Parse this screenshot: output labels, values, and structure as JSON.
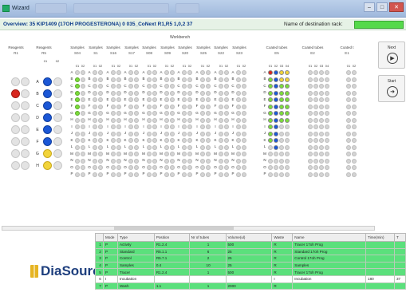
{
  "window": {
    "title": "Wizard",
    "controls": {
      "minimize": "–",
      "maximize": "□",
      "close": "✕"
    }
  },
  "overview": {
    "text": "Overview: 35 KIP1409 (17OH PROGESTERONA) 0 035_CoNext R1,R5 1,0,2 37",
    "rack_label": "Name of destination rack:",
    "rack_value": ""
  },
  "workbench": {
    "label": "Workbench",
    "columns": [
      {
        "id": "reagents1",
        "head": "Reagents",
        "sub": "R1"
      },
      {
        "id": "reagents2",
        "head": "Reagents",
        "sub": "R5"
      },
      {
        "id": "s1",
        "head": "Samples",
        "sub": "S04"
      },
      {
        "id": "s2",
        "head": "Samples",
        "sub": "S1"
      },
      {
        "id": "s3",
        "head": "Samples",
        "sub": "S16"
      },
      {
        "id": "s4",
        "head": "Samples",
        "sub": "S17"
      },
      {
        "id": "s5",
        "head": "Samples",
        "sub": "S08"
      },
      {
        "id": "s6",
        "head": "Samples",
        "sub": "S09"
      },
      {
        "id": "s7",
        "head": "Samples",
        "sub": "S20"
      },
      {
        "id": "s8",
        "head": "Samples",
        "sub": "S25"
      },
      {
        "id": "s9",
        "head": "Samples",
        "sub": "S22"
      },
      {
        "id": "s10",
        "head": "Samples",
        "sub": "S23"
      },
      {
        "id": "ct1",
        "head": "Coated tubes",
        "sub": "E5"
      },
      {
        "id": "ct2",
        "head": "Coated tubes",
        "sub": "E2"
      },
      {
        "id": "ct3",
        "head": "Coated t",
        "sub": "E1"
      }
    ],
    "sub_ids": [
      "01",
      "02"
    ],
    "ct_ids_1": [
      "01",
      "02",
      "03",
      "04"
    ],
    "ct_ids_2": [
      "01",
      "02",
      "03",
      "04"
    ],
    "ct_ids_3": [
      "01",
      "02"
    ],
    "row_letters": [
      "A",
      "B",
      "C",
      "D",
      "E",
      "F",
      "G",
      "H",
      "I",
      "J",
      "K",
      "L",
      "M",
      "N",
      "O",
      "P"
    ],
    "big_row_letters": [
      "A",
      "B",
      "C",
      "D",
      "E",
      "F",
      "G",
      "H"
    ]
  },
  "buttons": {
    "next": {
      "label": "Next",
      "icon": "▶"
    },
    "start": {
      "label": "Start",
      "icon": "➜"
    }
  },
  "brand": {
    "name": "DiaSource",
    "mark": "®"
  },
  "steps_table": {
    "headers": [
      "",
      "Mode",
      "Type",
      "Position",
      "Nr of tubes",
      "Volume(ul)",
      "Waste",
      "Name",
      "Time(min)",
      "T"
    ],
    "rows": [
      [
        "1",
        "P",
        "Activity",
        "R1.2.4",
        "1",
        "500",
        "R",
        "Tracer 17oh Prog",
        "",
        ""
      ],
      [
        "2",
        "P",
        "Standard",
        "R5.1.1",
        "6",
        "25",
        "R",
        "Standard 17oh Prog",
        "",
        ""
      ],
      [
        "3",
        "P",
        "Control",
        "R5.7.1",
        "2",
        "25",
        "R",
        "Control 17oh Prog",
        "",
        ""
      ],
      [
        "4",
        "P",
        "Samples",
        "0.4",
        "10",
        "25",
        "R",
        "Samples",
        "",
        ""
      ],
      [
        "5",
        "P",
        "Tracer",
        "R1.2.4",
        "1",
        "500",
        "R",
        "Tracer 17oh Prog",
        "",
        ""
      ],
      [
        "6",
        "I",
        "Incubation",
        "",
        "",
        "",
        "I",
        "Incubation",
        "180",
        "37"
      ],
      [
        "7",
        "P",
        "Wash",
        "1.1",
        "1",
        "2000",
        "R",
        "",
        "",
        ""
      ]
    ],
    "row_styles": [
      "green",
      "green",
      "green",
      "green",
      "green",
      "white",
      "green"
    ]
  },
  "colors": {
    "green": "#5be07c",
    "red": "#d8261e",
    "blue": "#1b57d6",
    "yellow": "#f2d43a",
    "lime": "#7cdc3a",
    "gray": "#d4d4d4",
    "accent_text": "#0a3a8a",
    "brand": "#1d3e7d"
  }
}
